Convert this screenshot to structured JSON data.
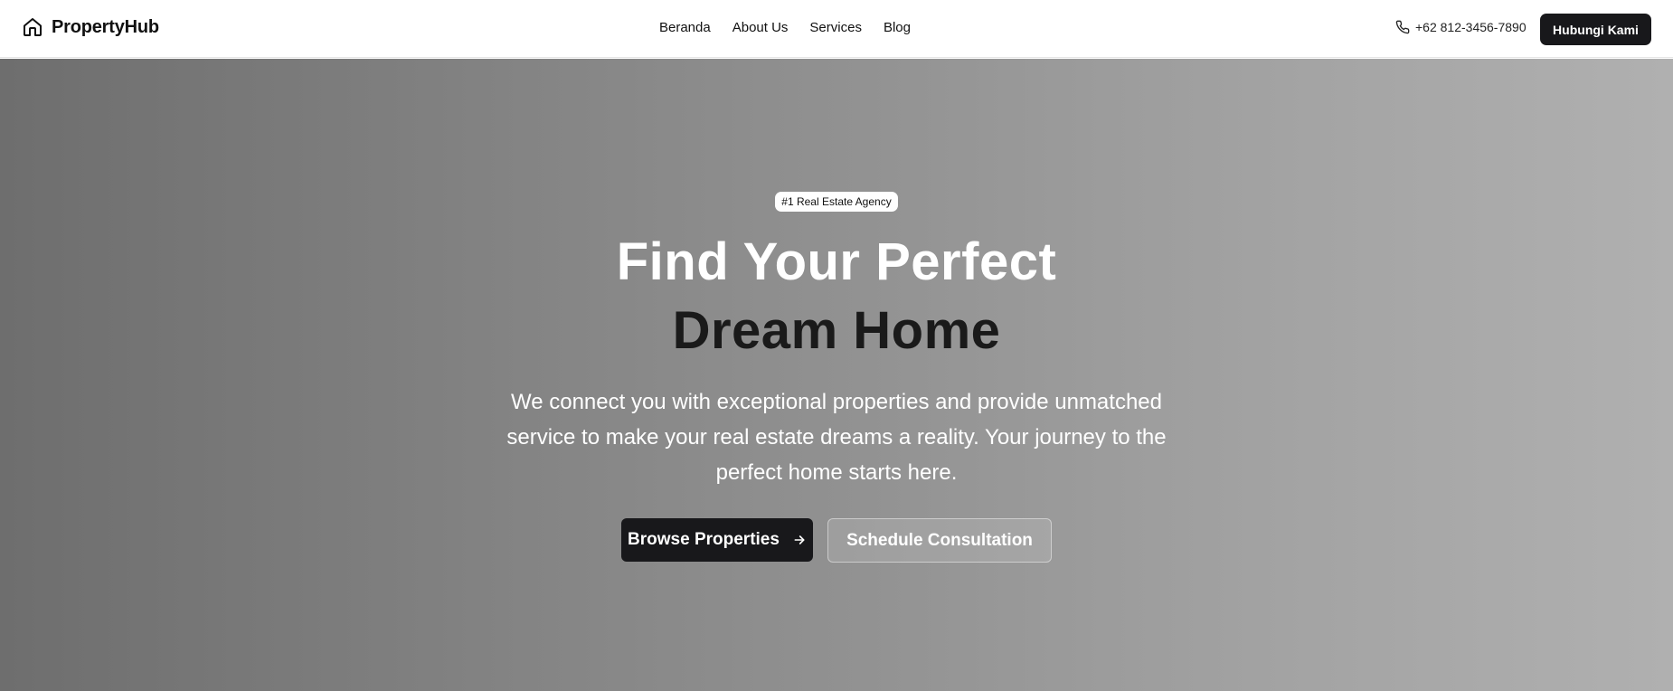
{
  "header": {
    "brand_icon": "home-icon",
    "brand_name": "PropertyHub",
    "nav_links": [
      "Beranda",
      "About Us",
      "Services",
      "Blog"
    ],
    "phone_icon": "phone-icon",
    "phone_number": "+62 812-3456-7890",
    "contact_button_label": "Hubungi Kami"
  },
  "hero": {
    "badge": "#1 Real Estate Agency",
    "headline_line1": "Find Your Perfect",
    "headline_line2": "Dream Home",
    "subtext": "We connect you with exceptional properties and provide unmatched service to make your real estate dreams a reality. Your journey to the perfect home starts here.",
    "primary_button_label": "Browse Properties",
    "primary_button_icon": "arrow-right-icon",
    "secondary_button_label": "Schedule Consultation"
  },
  "colors": {
    "text_dark": "#111111",
    "button_dark": "#18181b",
    "white": "#ffffff",
    "hero_gradient_start": "#6e6e6e",
    "hero_gradient_end": "#b0b0b0"
  }
}
